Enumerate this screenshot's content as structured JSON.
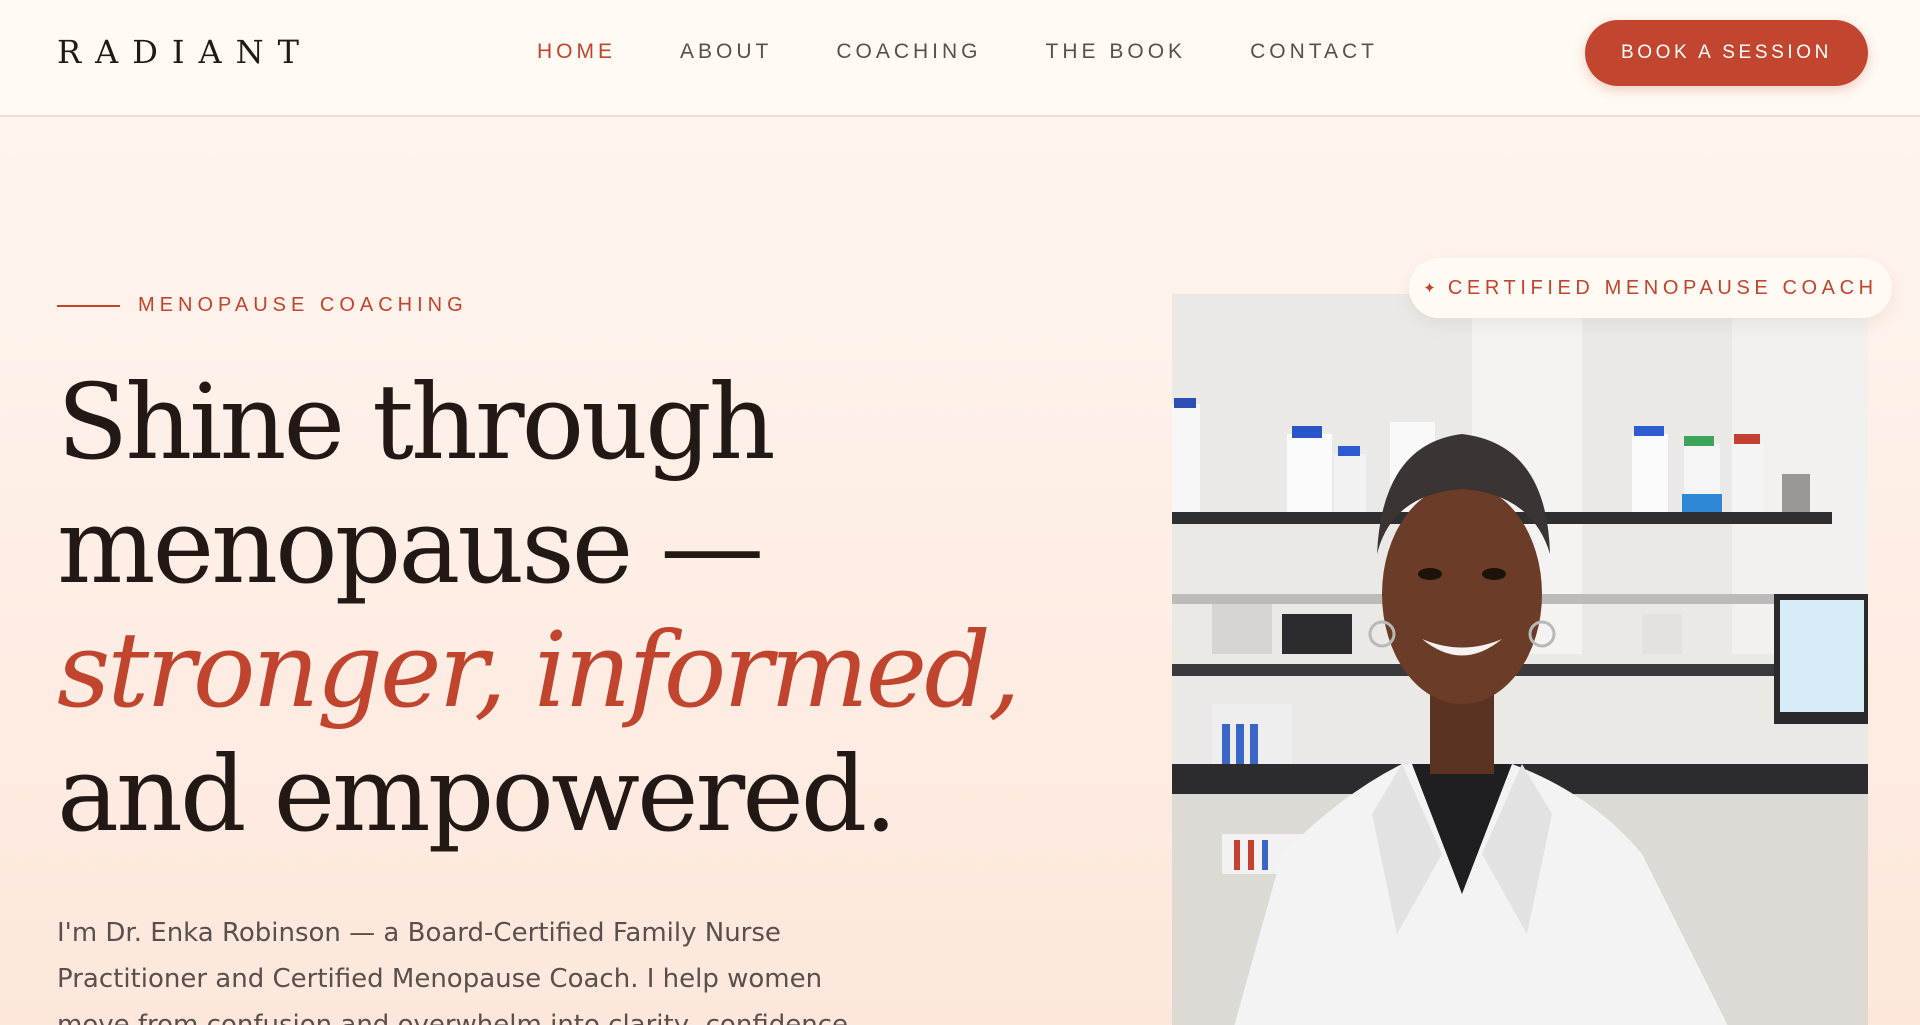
{
  "header": {
    "logo": "RADIANT",
    "nav": [
      {
        "label": "HOME",
        "active": true
      },
      {
        "label": "ABOUT",
        "active": false
      },
      {
        "label": "COACHING",
        "active": false
      },
      {
        "label": "THE BOOK",
        "active": false
      },
      {
        "label": "CONTACT",
        "active": false
      }
    ],
    "cta_label": "BOOK A SESSION"
  },
  "hero": {
    "eyebrow": "MENOPAUSE COACHING",
    "headline": {
      "line1": "Shine through",
      "line2": "menopause —",
      "line3_accent": "stronger, informed,",
      "line4": "and empowered."
    },
    "intro": "I'm Dr. Enka Robinson — a Board-Certified Family Nurse Practitioner and Certified Menopause Coach. I help women move from confusion and overwhelm into clarity, confidence"
  },
  "badge": {
    "icon": "sparkle-icon",
    "text": "CERTIFIED MENOPAUSE COACH"
  },
  "photo": {
    "subject": "portrait-photo"
  },
  "colors": {
    "accent": "#c0442e",
    "button": "#c2462f",
    "text_dark": "#221916",
    "text_muted": "#5a4f4b",
    "background": "#fff7f0"
  }
}
